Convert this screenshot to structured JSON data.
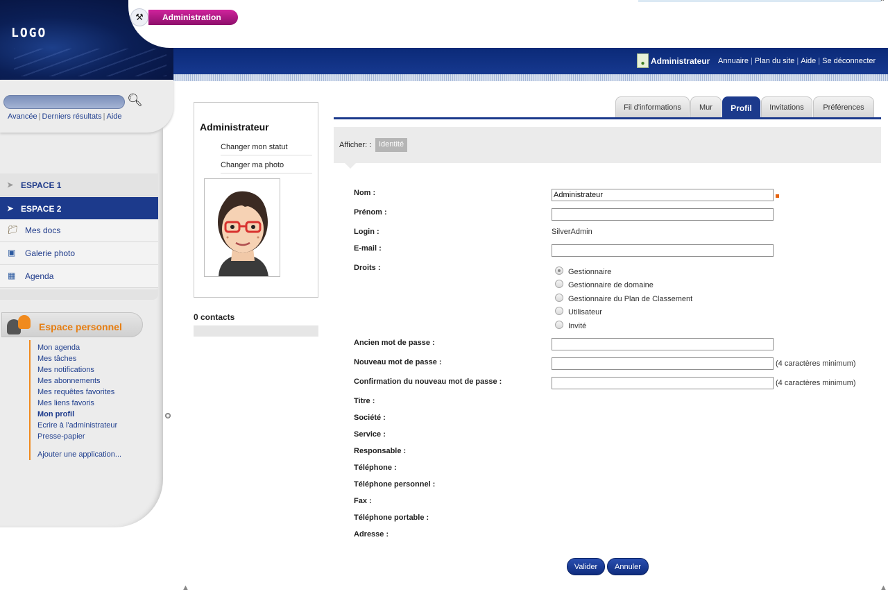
{
  "header": {
    "logo": "LOGO",
    "admin_label": "Administration",
    "user_name": "Administrateur",
    "links": [
      "Annuaire",
      "Plan du site",
      "Aide",
      "Se déconnecter"
    ]
  },
  "search": {
    "placeholder": "",
    "links": [
      "Avancée",
      "Derniers résultats",
      "Aide"
    ]
  },
  "spaces": {
    "space1": "ESPACE 1",
    "space2": "ESPACE 2",
    "items": [
      {
        "label": "Mes docs",
        "icon": "folder-icon"
      },
      {
        "label": "Galerie photo",
        "icon": "gallery-icon"
      },
      {
        "label": "Agenda",
        "icon": "calendar-icon"
      }
    ]
  },
  "personal": {
    "title": "Espace personnel",
    "links": [
      "Mon agenda",
      "Mes tâches",
      "Mes notifications",
      "Mes abonnements",
      "Mes requêtes favorites",
      "Mes liens favoris",
      "Mon profil",
      "Ecrire à l'administrateur",
      "Presse-papier"
    ],
    "add_app": "Ajouter une application..."
  },
  "profile_card": {
    "name": "Administrateur",
    "change_status": "Changer mon statut",
    "change_photo": "Changer ma photo",
    "contacts": "0 contacts"
  },
  "tabs": [
    "Fil d'informations",
    "Mur",
    "Profil",
    "Invitations",
    "Préférences"
  ],
  "active_tab": "Profil",
  "filter": {
    "label": "Afficher: :",
    "chip": "Identité"
  },
  "form": {
    "nom_label": "Nom :",
    "nom_value": "Administrateur",
    "prenom_label": "Prénom :",
    "prenom_value": "",
    "login_label": "Login :",
    "login_value": "SilverAdmin",
    "email_label": "E-mail :",
    "email_value": "",
    "droits_label": "Droits :",
    "droits_options": [
      "Gestionnaire",
      "Gestionnaire de domaine",
      "Gestionnaire du Plan de Classement",
      "Utilisateur",
      "Invité"
    ],
    "droits_selected": "Gestionnaire",
    "old_pwd_label": "Ancien mot de passe :",
    "new_pwd_label": "Nouveau mot de passe :",
    "confirm_pwd_label": "Confirmation du nouveau mot de passe :",
    "pwd_hint": "(4 caractères minimum)",
    "extra_labels": [
      "Titre :",
      "Société :",
      "Service :",
      "Responsable :",
      "Téléphone :",
      "Téléphone personnel :",
      "Fax :",
      "Téléphone portable :",
      "Adresse :"
    ]
  },
  "buttons": {
    "submit": "Valider",
    "cancel": "Annuler"
  },
  "colors": {
    "primary": "#1c3a8c",
    "accent_orange": "#f08a1e",
    "admin_pink": "#c21e90",
    "required_marker": "#e5620e"
  }
}
